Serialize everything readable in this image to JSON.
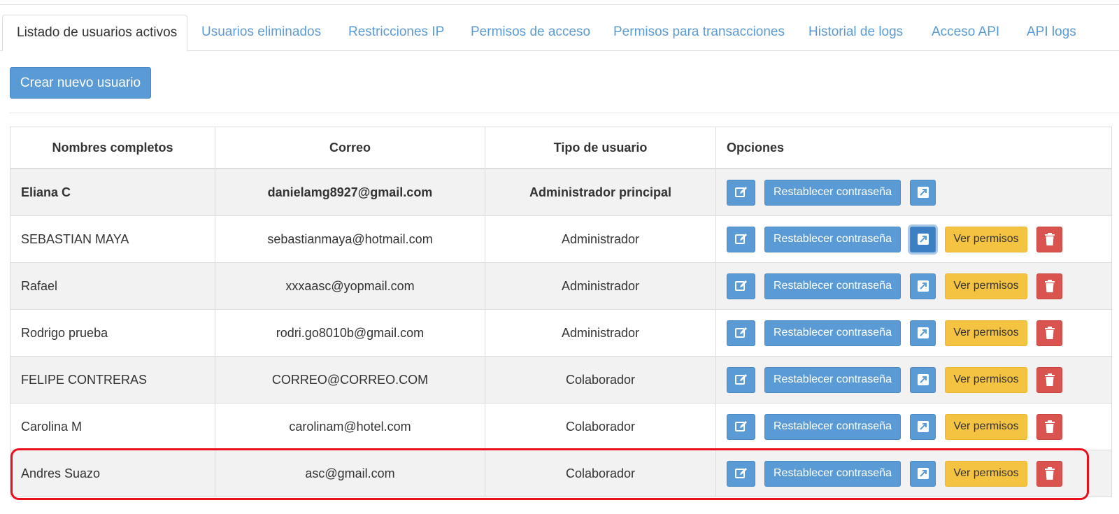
{
  "tabs": [
    {
      "label": "Listado de usuarios activos",
      "active": true
    },
    {
      "label": "Usuarios eliminados"
    },
    {
      "label": "Restricciones IP"
    },
    {
      "label": "Permisos de acceso"
    },
    {
      "label": "Permisos para transacciones"
    },
    {
      "label": "Historial de logs"
    },
    {
      "label": "Acceso API"
    },
    {
      "label": "API logs"
    }
  ],
  "create_button": "Crear nuevo usuario",
  "table": {
    "headers": {
      "name": "Nombres completos",
      "email": "Correo",
      "type": "Tipo de usuario",
      "options": "Opciones"
    },
    "rows": [
      {
        "name": "Eliana C",
        "email": "danielamg8927@gmail.com",
        "type": "Administrador principal"
      },
      {
        "name": "SEBASTIAN MAYA",
        "email": "sebastianmaya@hotmail.com",
        "type": "Administrador"
      },
      {
        "name": "Rafael",
        "email": "xxxaasc@yopmail.com",
        "type": "Administrador"
      },
      {
        "name": "Rodrigo prueba",
        "email": "rodri.go8010b@gmail.com",
        "type": "Administrador"
      },
      {
        "name": "FELIPE CONTRERAS",
        "email": "CORREO@CORREO.COM",
        "type": "Colaborador"
      },
      {
        "name": "Carolina M",
        "email": "carolinam@hotel.com",
        "type": "Colaborador"
      },
      {
        "name": "Andres Suazo",
        "email": "asc@gmail.com",
        "type": "Colaborador"
      }
    ]
  },
  "row_buttons": {
    "edit_icon": "edit-icon",
    "reset_label": "Restablecer contraseña",
    "login_icon": "external-link-icon",
    "permissions_label": "Ver permisos",
    "delete_icon": "trash-icon"
  },
  "colors": {
    "primary": "#5b9bd5",
    "warning": "#f5c342",
    "danger": "#d9534f",
    "highlight": "#e8101a",
    "tab_link": "#5b9bd5"
  }
}
